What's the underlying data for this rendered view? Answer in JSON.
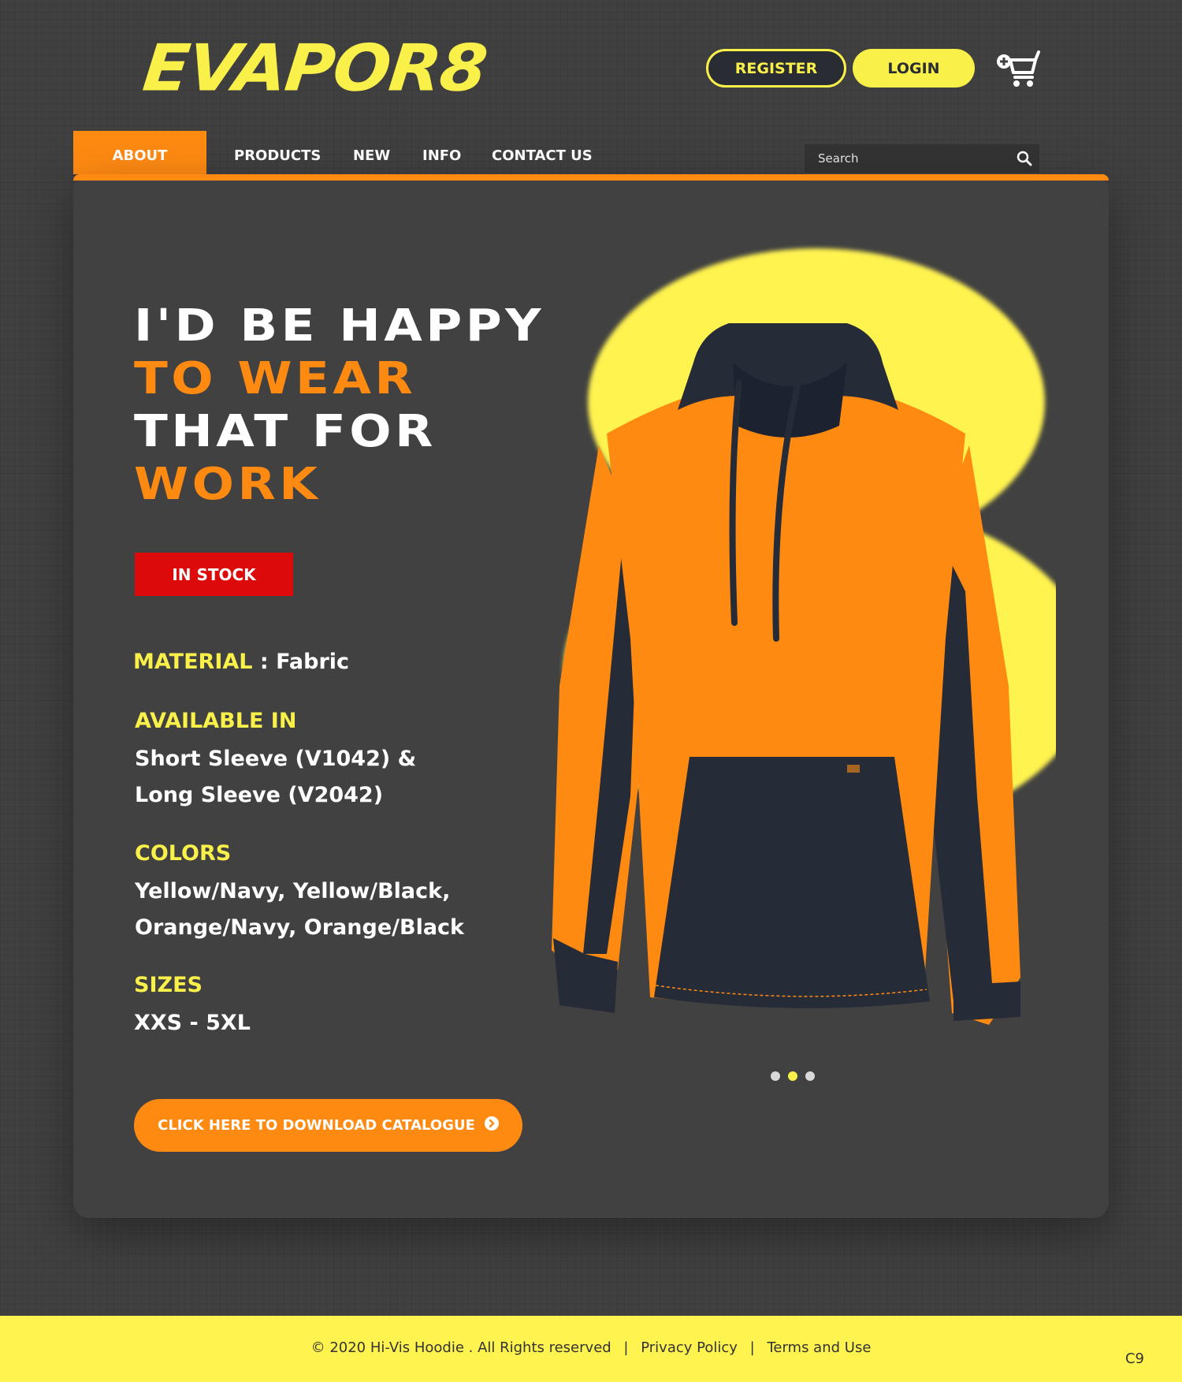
{
  "brand": {
    "logo_text": "EVAPOR8"
  },
  "header": {
    "register_label": "REGISTER",
    "login_label": "LOGIN"
  },
  "nav": {
    "items": [
      {
        "label": "ABOUT",
        "active": true
      },
      {
        "label": "PRODUCTS"
      },
      {
        "label": "NEW"
      },
      {
        "label": "INFO"
      },
      {
        "label": "CONTACT US"
      }
    ]
  },
  "search": {
    "placeholder": "Search"
  },
  "hero": {
    "headline": [
      "I'D BE HAPPY",
      "TO WEAR",
      "THAT FOR",
      "WORK"
    ],
    "stock_badge": "IN STOCK",
    "material_label": "MATERIAL",
    "material_value": " : Fabric",
    "available_label": "AVAILABLE IN",
    "available_lines": [
      "Short Sleeve (V1042) &",
      "Long Sleeve (V2042)"
    ],
    "colors_label": "COLORS",
    "colors_lines": [
      "Yellow/Navy, Yellow/Black,",
      "Orange/Navy, Orange/Black"
    ],
    "sizes_label": "SIZES",
    "sizes_value": "XXS - 5XL",
    "download_label": "CLICK HERE TO DOWNLOAD CATALOGUE"
  },
  "carousel": {
    "slide_count": 3,
    "active_index": 1
  },
  "footer": {
    "copyright": "© 2020 Hi-Vis Hoodie . All Rights reserved",
    "separator": "|",
    "privacy": "Privacy Policy",
    "terms": "Terms and Use",
    "code": "C9"
  },
  "colors": {
    "accent_yellow": "#f9f04a",
    "accent_orange": "#ff8a12",
    "badge_red": "#dc0a0a",
    "background": "#404040"
  },
  "icons": {
    "cart": "shopping-cart-icon",
    "search": "search-icon",
    "download": "chevron-circle-right-icon"
  }
}
